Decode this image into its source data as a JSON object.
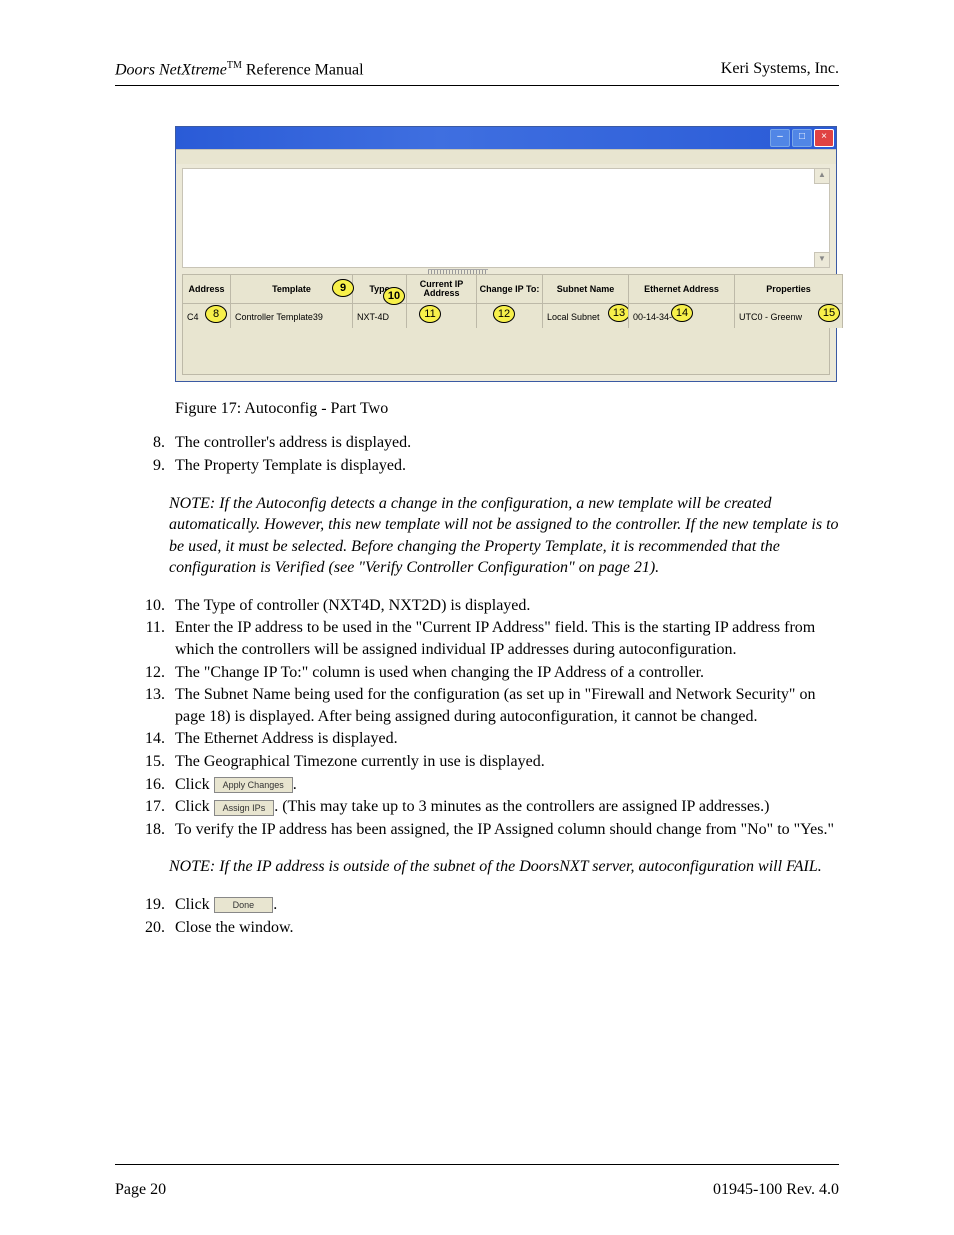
{
  "header": {
    "product": "Doors NetXtreme",
    "tm": "TM",
    "suffix": " Reference Manual",
    "company": "Keri Systems, Inc."
  },
  "footer": {
    "page_label": "Page 20",
    "doc_id": "01945-100  Rev. 4.0"
  },
  "window": {
    "minimize": "–",
    "maximize": "□",
    "close": "×",
    "columns": {
      "address": "Address",
      "template": "Template",
      "type": "Type",
      "current_ip": "Current IP Address",
      "change_ip": "Change IP To:",
      "subnet": "Subnet Name",
      "ethernet": "Ethernet Address",
      "properties": "Properties"
    },
    "row": {
      "address": "C4",
      "template": "Controller Template39",
      "type": "NXT-4D",
      "current_ip": "",
      "change_ip": "",
      "subnet": "Local Subnet",
      "ethernet": "00-14-34-      -0C",
      "properties": "UTC0 - Greenw"
    },
    "callouts": {
      "c8": "8",
      "c9": "9",
      "c10": "10",
      "c11": "11",
      "c12": "12",
      "c13": "13",
      "c14": "14",
      "c15": "15"
    }
  },
  "caption": "Figure 17: Autoconfig - Part Two",
  "steps_a": {
    "s8": "The controller's address is displayed.",
    "s9": "The Property Template is displayed."
  },
  "note1": "NOTE: If the Autoconfig detects a change in the configuration, a new template will be created automatically. However, this new template will not be assigned to the controller. If the new template is to be used, it must be selected. Before changing the Property Template, it is recommended that the configuration is Verified (see \"Verify Controller Configuration\" on page 21).",
  "steps_b": {
    "s10": "The Type of controller (NXT4D, NXT2D) is displayed.",
    "s11": "Enter the IP address to be used in the \"Current IP Address\" field. This is the starting IP address from which the controllers will be assigned individual IP addresses during autoconfiguration.",
    "s12": "The \"Change IP To:\" column is used when changing the IP Address of a controller.",
    "s13": "The Subnet Name being used for the configuration (as set up in \"Firewall and Network Security\" on page 18) is displayed. After being assigned during autoconfiguration, it cannot be changed.",
    "s14": "The Ethernet Address is displayed.",
    "s15": "The Geographical Timezone currently in use is displayed.",
    "s16_prefix": "Click ",
    "s16_btn": "Apply Changes",
    "s16_suffix": ".",
    "s17_prefix": "Click ",
    "s17_btn": "Assign IPs",
    "s17_suffix": ". (This may take up to 3 minutes as the controllers are assigned IP addresses.)",
    "s18": "To verify the IP address has been assigned, the IP Assigned column should change from \"No\" to \"Yes.\""
  },
  "note2": "NOTE: If the IP address is outside of the subnet of the DoorsNXT server, autoconfiguration will FAIL.",
  "steps_c": {
    "s19_prefix": "Click ",
    "s19_btn": "Done",
    "s19_suffix": ".",
    "s20": "Close the window."
  }
}
